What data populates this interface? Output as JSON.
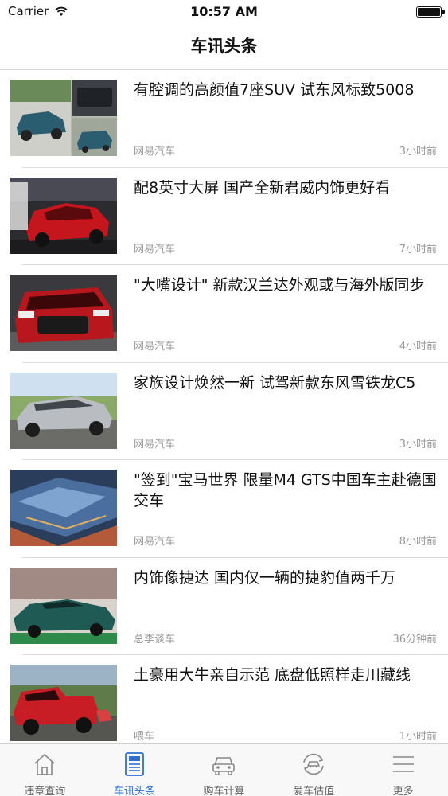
{
  "status_bar": {
    "carrier": "Carrier",
    "time": "10:57 AM"
  },
  "nav": {
    "title": "车讯头条"
  },
  "news": [
    {
      "headline": "有腔调的高颜值7座SUV 试东风标致5008",
      "source": "网易汽车",
      "time": "3小时前",
      "image": "blue-suv-collage"
    },
    {
      "headline": "配8英寸大屏 国产全新君威内饰更好看",
      "source": "网易汽车",
      "time": "7小时前",
      "image": "red-sedan-showroom"
    },
    {
      "headline": "\"大嘴设计\" 新款汉兰达外观或与海外版同步",
      "source": "网易汽车",
      "time": "4小时前",
      "image": "red-suv-front"
    },
    {
      "headline": "家族设计焕然一新 试驾新款东风雪铁龙C5",
      "source": "网易汽车",
      "time": "3小时前",
      "image": "silver-sedan-road"
    },
    {
      "headline": "\"签到\"宝马世界 限量M4 GTS中国车主赴德国交车",
      "source": "网易汽车",
      "time": "8小时前",
      "image": "bmw-world-aerial"
    },
    {
      "headline": "内饰像捷达 国内仅一辆的捷豹值两千万",
      "source": "总李谈车",
      "time": "36分钟前",
      "image": "green-sports-car"
    },
    {
      "headline": "土豪用大牛亲自示范 底盘低照样走川藏线",
      "source": "喂车",
      "time": "1小时前",
      "image": "red-pickup-road"
    }
  ],
  "tabs": [
    {
      "label": "违章查询",
      "icon": "house-icon",
      "active": false
    },
    {
      "label": "车讯头条",
      "icon": "news-icon",
      "active": true
    },
    {
      "label": "购车计算",
      "icon": "car-icon",
      "active": false
    },
    {
      "label": "爱车估值",
      "icon": "valuation-icon",
      "active": false
    },
    {
      "label": "更多",
      "icon": "menu-icon",
      "active": false
    }
  ],
  "colors": {
    "accent": "#2f6fd0",
    "tab_inactive": "#666666",
    "meta_text": "#999999"
  }
}
